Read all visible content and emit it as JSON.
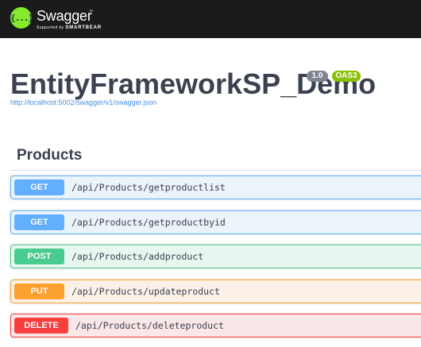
{
  "topbar": {
    "logo_glyph": "{...}",
    "logo_text": "Swagger",
    "logo_tm": "™",
    "supported_prefix": "Supported by",
    "supported_brand": "SMARTBEAR",
    "colors": {
      "bar": "#1b1b1b",
      "logo": "#85ea2d"
    },
    "icon": "swagger-logo-icon"
  },
  "info": {
    "title": "EntityFrameworkSP_Demo",
    "version": "1.0",
    "oas_badge": "OAS3",
    "spec_url": "http://localhost:5002/swagger/v1/swagger.json"
  },
  "section": {
    "title": "Products"
  },
  "operations": [
    {
      "method": "GET",
      "path": "/api/Products/getproductlist",
      "color": "#61affe"
    },
    {
      "method": "GET",
      "path": "/api/Products/getproductbyid",
      "color": "#61affe"
    },
    {
      "method": "POST",
      "path": "/api/Products/addproduct",
      "color": "#49cc90"
    },
    {
      "method": "PUT",
      "path": "/api/Products/updateproduct",
      "color": "#fca130"
    },
    {
      "method": "DELETE",
      "path": "/api/Products/deleteproduct",
      "color": "#f93e3e"
    }
  ]
}
